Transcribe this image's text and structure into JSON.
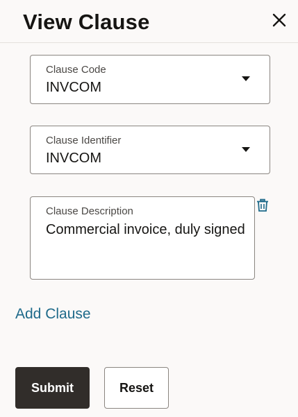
{
  "dialog": {
    "title": "View Clause",
    "close_icon": "close-icon"
  },
  "fields": {
    "clause_code": {
      "label": "Clause Code",
      "value": "INVCOM"
    },
    "clause_identifier": {
      "label": "Clause Identifier",
      "value": "INVCOM"
    },
    "clause_description": {
      "label": "Clause Description",
      "value": "Commercial invoice, duly signed"
    }
  },
  "actions": {
    "add_clause": "Add Clause",
    "submit": "Submit",
    "reset": "Reset"
  },
  "colors": {
    "link": "#1e6a8a",
    "primary_button": "#312d2a",
    "background": "#fbf9f8"
  }
}
